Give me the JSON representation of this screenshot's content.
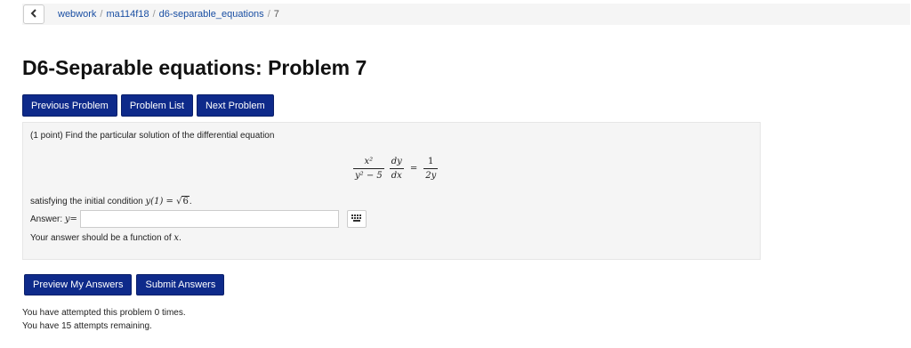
{
  "breadcrumb": {
    "back_icon": "chevron-left-icon",
    "course_root": "webwork",
    "course": "ma114f18",
    "set": "d6-separable_equations",
    "problem": "7",
    "separator": "/"
  },
  "page_title": "D6-Separable equations: Problem 7",
  "nav": {
    "previous_label": "Previous Problem",
    "list_label": "Problem List",
    "next_label": "Next Problem"
  },
  "problem": {
    "intro": "(1 point) Find the particular solution of the differential equation",
    "equation": {
      "lhs_num": "x²",
      "lhs_den": "y² − 5",
      "deriv_num": "dy",
      "deriv_den": "dx",
      "eq": "=",
      "rhs_num": "1",
      "rhs_den": "2y"
    },
    "initial_condition_prefix": "satisfying the initial condition",
    "initial_condition_lhs": "y(1) = ",
    "sqrt_symbol": "√",
    "initial_condition_value": "6",
    "initial_condition_suffix": ".",
    "answer_label": "Answer:",
    "answer_var": "y=",
    "answer_value": "",
    "keyboard_icon": "equation-editor-icon",
    "hint_prefix": "Your answer should be a function of",
    "hint_var": "x",
    "hint_suffix": "."
  },
  "actions": {
    "preview_label": "Preview My Answers",
    "submit_label": "Submit Answers"
  },
  "attempts": {
    "made": "You have attempted this problem 0 times.",
    "remaining": "You have 15 attempts remaining."
  },
  "colors": {
    "button_bg": "#0e2a8a",
    "link": "#1a4fa3",
    "panel_bg": "#f5f5f5"
  }
}
